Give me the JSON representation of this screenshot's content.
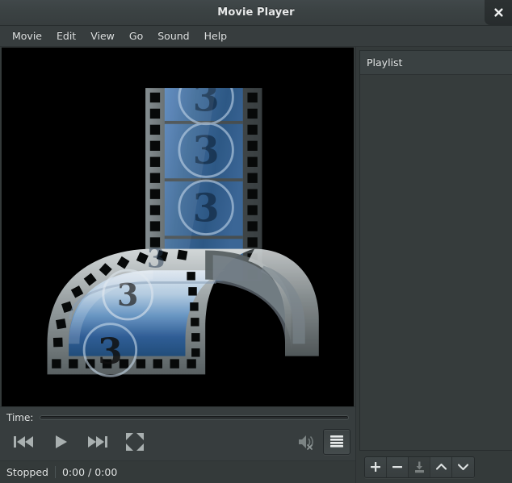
{
  "window": {
    "title": "Movie Player",
    "close_icon": "close-icon"
  },
  "menubar": {
    "items": [
      {
        "label": "Movie"
      },
      {
        "label": "Edit"
      },
      {
        "label": "View"
      },
      {
        "label": "Go"
      },
      {
        "label": "Sound"
      },
      {
        "label": "Help"
      }
    ]
  },
  "video": {
    "logo_name": "film-strip-logo",
    "frame_number": "3",
    "background_color": "#000000"
  },
  "controls": {
    "time_label": "Time:",
    "seek_value": 0,
    "buttons": [
      {
        "name": "previous-button",
        "icon": "skip-previous-icon"
      },
      {
        "name": "play-button",
        "icon": "play-icon"
      },
      {
        "name": "next-button",
        "icon": "skip-next-icon"
      },
      {
        "name": "fullscreen-button",
        "icon": "fullscreen-icon"
      }
    ],
    "volume": {
      "name": "volume-button",
      "icon": "volume-muted-icon",
      "muted": true
    },
    "sidebar_toggle": {
      "name": "sidebar-toggle-button",
      "icon": "playlist-icon",
      "pressed": true
    }
  },
  "statusbar": {
    "state": "Stopped",
    "time": "0:00 / 0:00"
  },
  "playlist": {
    "header": "Playlist",
    "items": [],
    "toolbar": [
      {
        "name": "playlist-add-button",
        "icon": "plus-icon",
        "disabled": false
      },
      {
        "name": "playlist-remove-button",
        "icon": "minus-icon",
        "disabled": false
      },
      {
        "name": "playlist-save-button",
        "icon": "save-icon",
        "disabled": true
      },
      {
        "name": "playlist-move-up-button",
        "icon": "chevron-up-icon",
        "disabled": false
      },
      {
        "name": "playlist-move-down-button",
        "icon": "chevron-down-icon",
        "disabled": false
      }
    ]
  },
  "colors": {
    "chrome": "#373d3e",
    "panel": "#343a3a",
    "list": "#363c3c",
    "text": "#e2e5e5",
    "video_bg": "#000000",
    "icon": "#a9b0b0",
    "logo_blue": "#3f6fa8"
  }
}
